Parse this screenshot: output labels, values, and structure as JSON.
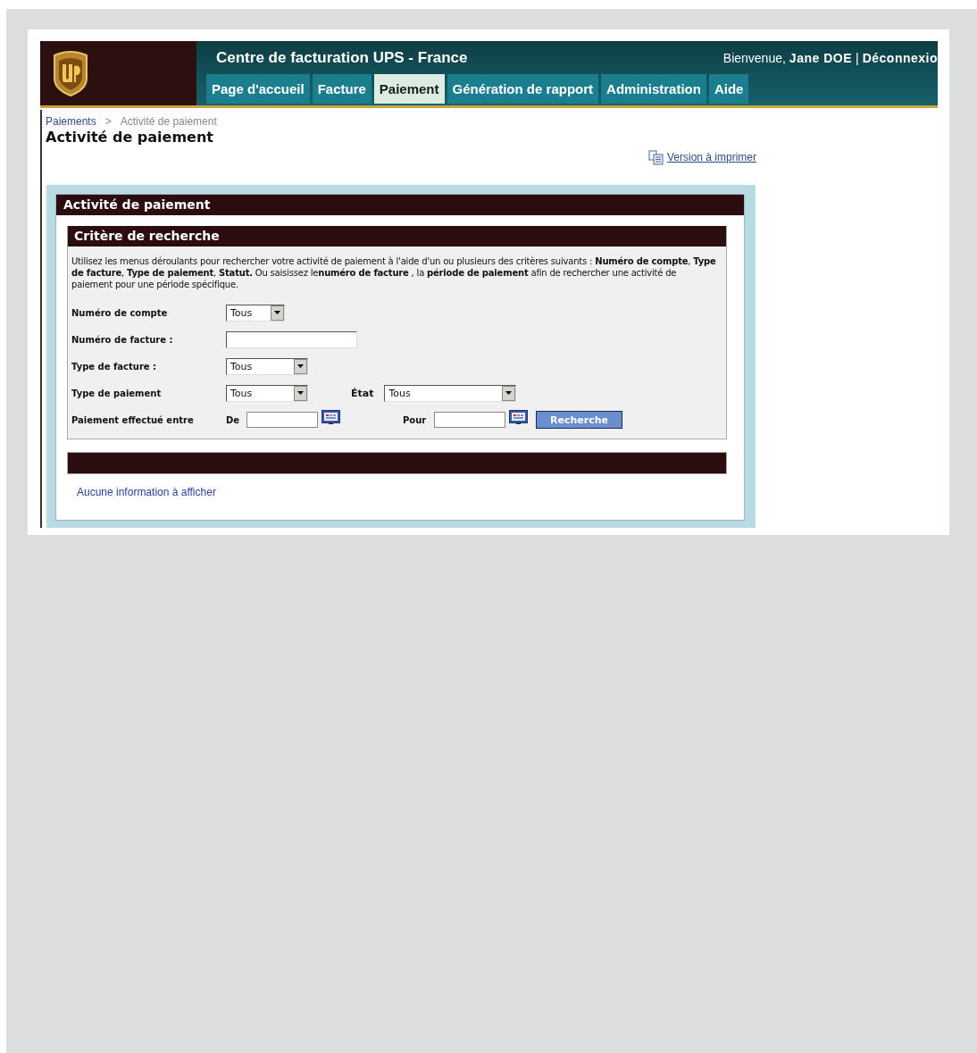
{
  "header": {
    "title": "Centre de facturation UPS - France",
    "welcome": "Bienvenue,",
    "user": "Jane DOE",
    "separator": "|",
    "logout": "Déconnexio"
  },
  "tabs": [
    {
      "label": "Page d'accueil",
      "selected": false
    },
    {
      "label": "Facture",
      "selected": false
    },
    {
      "label": "Paiement",
      "selected": true
    },
    {
      "label": "Génération de rapport",
      "selected": false
    },
    {
      "label": "Administration",
      "selected": false
    },
    {
      "label": "Aide",
      "selected": false
    }
  ],
  "breadcrumb": {
    "link": "Paiements",
    "separator": ">",
    "current": "Activité de paiement"
  },
  "page_title": "Activité de paiement",
  "print_link": "Version à imprimer",
  "panel": {
    "title": "Activité de paiement",
    "criteria": {
      "title": "Critère de recherche",
      "description": "Utilisez les menus déroulants pour rechercher votre activité de paiement à l'aide d'un ou plusieurs des critères suivants : **Numéro de compte**, **Type de facture**, **Type de paiement**, **Statut.** Ou saisissez le**numéro de facture** , la **période de paiement** afin de rechercher une activité de paiement pour une période spécifique.",
      "fields": [
        {
          "kind": "select",
          "label": "Numéro de compte",
          "value": "Tous"
        },
        {
          "kind": "text",
          "label": "Numéro de facture :"
        },
        {
          "kind": "select",
          "label": "Type de facture :",
          "value": "Tous"
        },
        {
          "kind": "select",
          "label": "Type de paiement",
          "value": "Tous",
          "extra": {
            "label": "État",
            "value": "Tous"
          }
        },
        {
          "kind": "daterange",
          "label": "Paiement effectué entre",
          "from_label": "De",
          "to_label": "Pour",
          "button": "Recherche"
        }
      ]
    },
    "empty_message": "Aucune information à afficher"
  }
}
